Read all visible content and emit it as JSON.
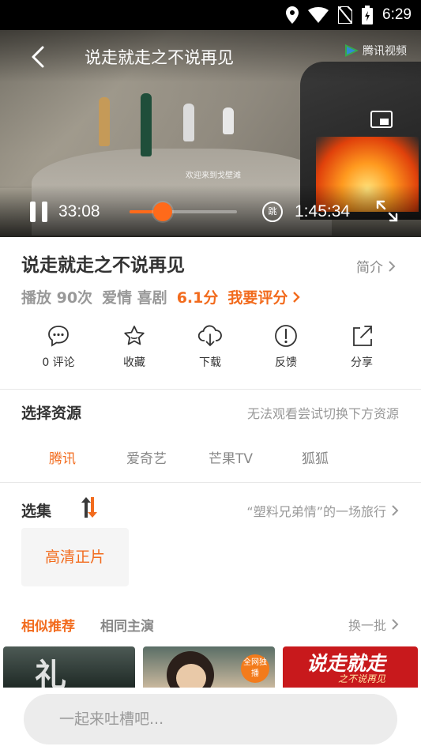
{
  "status_bar": {
    "time": "6:29"
  },
  "player": {
    "title": "说走就走之不说再见",
    "watermark": "腾讯视频",
    "subtitle": "欢迎来到戈壁滩",
    "current_time": "33:08",
    "total_time": "1:45:34",
    "progress": 0.31,
    "skip_label": "跳"
  },
  "movie": {
    "title": "说走就走之不说再见",
    "intro_label": "简介",
    "plays": "播放 90次",
    "genres": "爱情 喜剧",
    "score": "6.1分",
    "rate_label": "我要评分"
  },
  "actions": [
    {
      "name": "comment",
      "label": "0 评论"
    },
    {
      "name": "favorite",
      "label": "收藏"
    },
    {
      "name": "download",
      "label": "下载"
    },
    {
      "name": "feedback",
      "label": "反馈"
    },
    {
      "name": "share",
      "label": "分享"
    }
  ],
  "sources": {
    "title": "选择资源",
    "hint": "无法观看尝试切换下方资源",
    "items": [
      "腾讯",
      "爱奇艺",
      "芒果TV",
      "狐狐"
    ],
    "active_index": 0
  },
  "episodes": {
    "title": "选集",
    "hint": "“塑料兄弟情”的一场旅行",
    "items": [
      "高清正片"
    ]
  },
  "recommend": {
    "tab_similar": "相似推荐",
    "tab_cast": "相同主演",
    "refresh_label": "换一批",
    "thumb3_title": "说走就走",
    "thumb3_sub": "之不说再见",
    "thumb2_badge": "全网独播"
  },
  "comment": {
    "placeholder": "一起来吐槽吧..."
  },
  "colors": {
    "accent": "#f26b1d",
    "status_bar": "#000000"
  }
}
